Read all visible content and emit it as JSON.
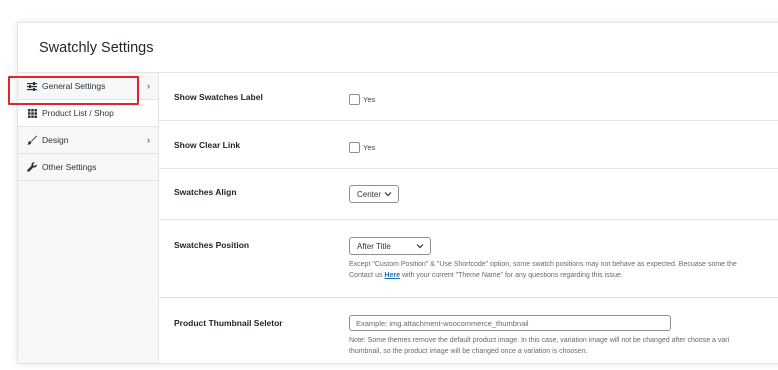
{
  "header": {
    "title": "Swatchly Settings"
  },
  "sidebar": {
    "items": [
      {
        "label": "General Settings",
        "icon": "sliders-icon",
        "chevron": "›"
      },
      {
        "label": "Product List / Shop",
        "icon": "grid-icon",
        "chevron": ""
      },
      {
        "label": "Design",
        "icon": "brush-icon",
        "chevron": "›"
      },
      {
        "label": "Other Settings",
        "icon": "wrench-icon",
        "chevron": ""
      }
    ]
  },
  "settings": {
    "show_swatches_label": {
      "label": "Show Swatches Label",
      "option": "Yes",
      "checked": false
    },
    "show_clear_link": {
      "label": "Show Clear Link",
      "option": "Yes",
      "checked": false
    },
    "swatches_align": {
      "label": "Swatches Align",
      "value": "Center"
    },
    "swatches_position": {
      "label": "Swatches Position",
      "value": "After Title",
      "desc_line1": "Except \"Custom Position\" & \"Use Shortcode\" option, some swatch positions may not behave as expected. Becuase some the",
      "desc_line2_pre": "Contact us ",
      "desc_link": "Here",
      "desc_line2_post": " with your current \"Theme Name\" for any questions regarding this issue."
    },
    "product_thumbnail_selector": {
      "label": "Product Thumbnail Seletor",
      "placeholder": "Example: img.attachment-woocommerce_thumbnail",
      "desc_line1": "Note: Some themes remove the default product image. In this case, variation image will not be changed after choose a vari",
      "desc_line2": "thumbnail, so the product image will be changed once a variation is choosen."
    }
  },
  "colors": {
    "highlight": "#e3242b",
    "link": "#2271b1"
  }
}
